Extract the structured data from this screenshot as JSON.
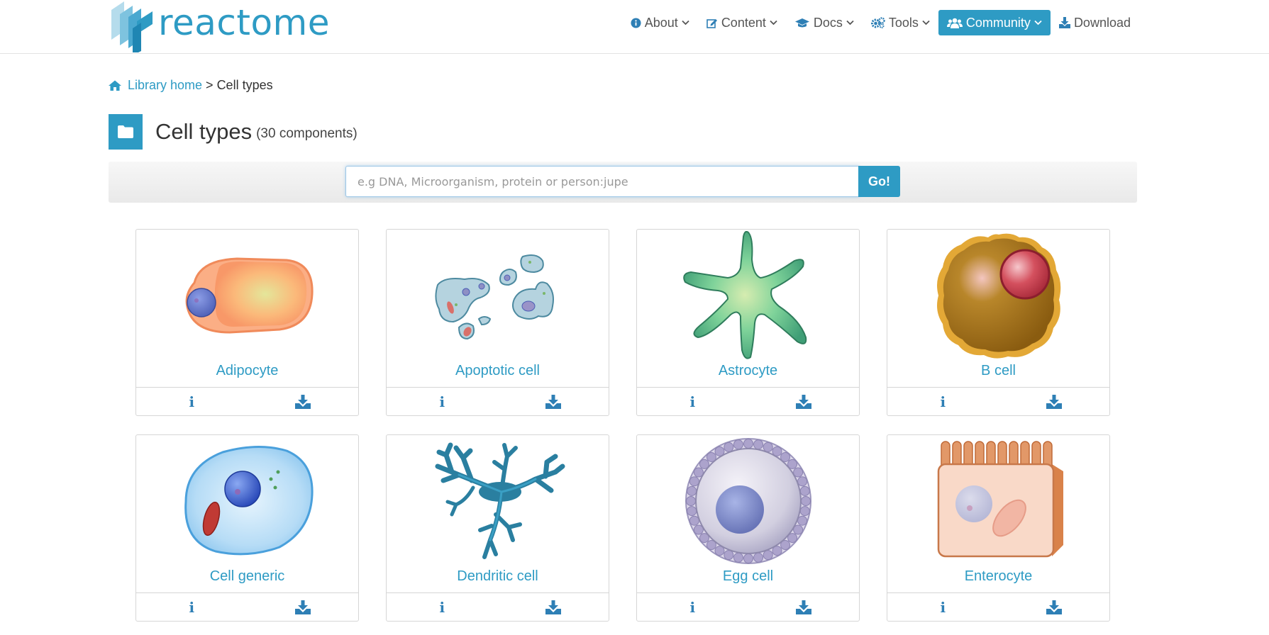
{
  "brand": {
    "name": "reactome",
    "color": "#2e9bc4"
  },
  "nav": [
    {
      "label": "About",
      "icon": "info-circle-icon",
      "active": false
    },
    {
      "label": "Content",
      "icon": "edit-icon",
      "active": false
    },
    {
      "label": "Docs",
      "icon": "graduation-cap-icon",
      "active": false
    },
    {
      "label": "Tools",
      "icon": "gears-icon",
      "active": false
    },
    {
      "label": "Community",
      "icon": "users-icon",
      "active": true
    },
    {
      "label": "Download",
      "icon": "download-icon",
      "active": false
    }
  ],
  "breadcrumb": {
    "home": "Library home",
    "separator": ">",
    "current": "Cell types"
  },
  "page": {
    "title": "Cell types",
    "count": "(30 components)"
  },
  "search": {
    "placeholder": "e.g DNA, Microorganism, protein or person:jupe",
    "value": "",
    "button": "Go!"
  },
  "cards": [
    {
      "label": "Adipocyte",
      "icon": "adipocyte-icon"
    },
    {
      "label": "Apoptotic cell",
      "icon": "apoptotic-cell-icon"
    },
    {
      "label": "Astrocyte",
      "icon": "astrocyte-icon"
    },
    {
      "label": "B cell",
      "icon": "b-cell-icon"
    },
    {
      "label": "Cell generic",
      "icon": "cell-generic-icon"
    },
    {
      "label": "Dendritic cell",
      "icon": "dendritic-cell-icon"
    },
    {
      "label": "Egg cell",
      "icon": "egg-cell-icon"
    },
    {
      "label": "Enterocyte",
      "icon": "enterocyte-icon"
    }
  ],
  "card_actions": {
    "info": "i",
    "download_icon": "download-icon"
  }
}
